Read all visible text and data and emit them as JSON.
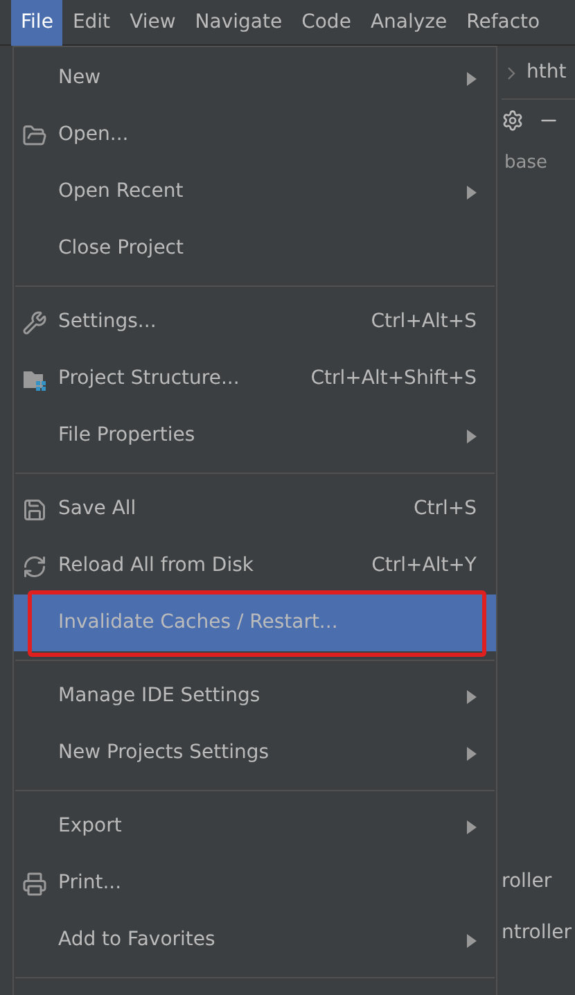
{
  "menu_bar": [
    {
      "label": "File",
      "selected": true
    },
    {
      "label": "Edit",
      "selected": false
    },
    {
      "label": "View",
      "selected": false
    },
    {
      "label": "Navigate",
      "selected": false
    },
    {
      "label": "Code",
      "selected": false
    },
    {
      "label": "Analyze",
      "selected": false
    },
    {
      "label": "Refacto",
      "selected": false
    }
  ],
  "background": {
    "breadcrumb": "htht",
    "tab_fragment": "base",
    "lines": [
      "roller",
      "ntroller"
    ]
  },
  "file_menu": [
    {
      "kind": "item",
      "label": "New",
      "submenu": true,
      "selected": false,
      "outlined": false
    },
    {
      "kind": "item",
      "label": "Open...",
      "submenu": false,
      "selected": false,
      "outlined": false
    },
    {
      "kind": "item",
      "label": "Open Recent",
      "submenu": true,
      "selected": false,
      "outlined": false
    },
    {
      "kind": "item",
      "label": "Close Project",
      "submenu": false,
      "selected": false,
      "outlined": false
    },
    {
      "kind": "separator"
    },
    {
      "kind": "item",
      "label": "Settings...",
      "shortcut": "Ctrl+Alt+S",
      "submenu": false,
      "selected": false,
      "outlined": false
    },
    {
      "kind": "item",
      "label": "Project Structure...",
      "shortcut": "Ctrl+Alt+Shift+S",
      "submenu": false,
      "selected": false,
      "outlined": false
    },
    {
      "kind": "item",
      "label": "File Properties",
      "submenu": true,
      "selected": false,
      "outlined": false
    },
    {
      "kind": "separator"
    },
    {
      "kind": "item",
      "label": "Save All",
      "shortcut": "Ctrl+S",
      "submenu": false,
      "selected": false,
      "outlined": false
    },
    {
      "kind": "item",
      "label": "Reload All from Disk",
      "shortcut": "Ctrl+Alt+Y",
      "submenu": false,
      "selected": false,
      "outlined": false
    },
    {
      "kind": "item",
      "label": "Invalidate Caches / Restart...",
      "submenu": false,
      "selected": true,
      "outlined": true
    },
    {
      "kind": "separator"
    },
    {
      "kind": "item",
      "label": "Manage IDE Settings",
      "submenu": true,
      "selected": false,
      "outlined": false
    },
    {
      "kind": "item",
      "label": "New Projects Settings",
      "submenu": true,
      "selected": false,
      "outlined": false
    },
    {
      "kind": "separator"
    },
    {
      "kind": "item",
      "label": "Export",
      "submenu": true,
      "selected": false,
      "outlined": false
    },
    {
      "kind": "item",
      "label": "Print...",
      "submenu": false,
      "selected": false,
      "outlined": false
    },
    {
      "kind": "item",
      "label": "Add to Favorites",
      "submenu": true,
      "selected": false,
      "outlined": false
    },
    {
      "kind": "separator"
    }
  ]
}
